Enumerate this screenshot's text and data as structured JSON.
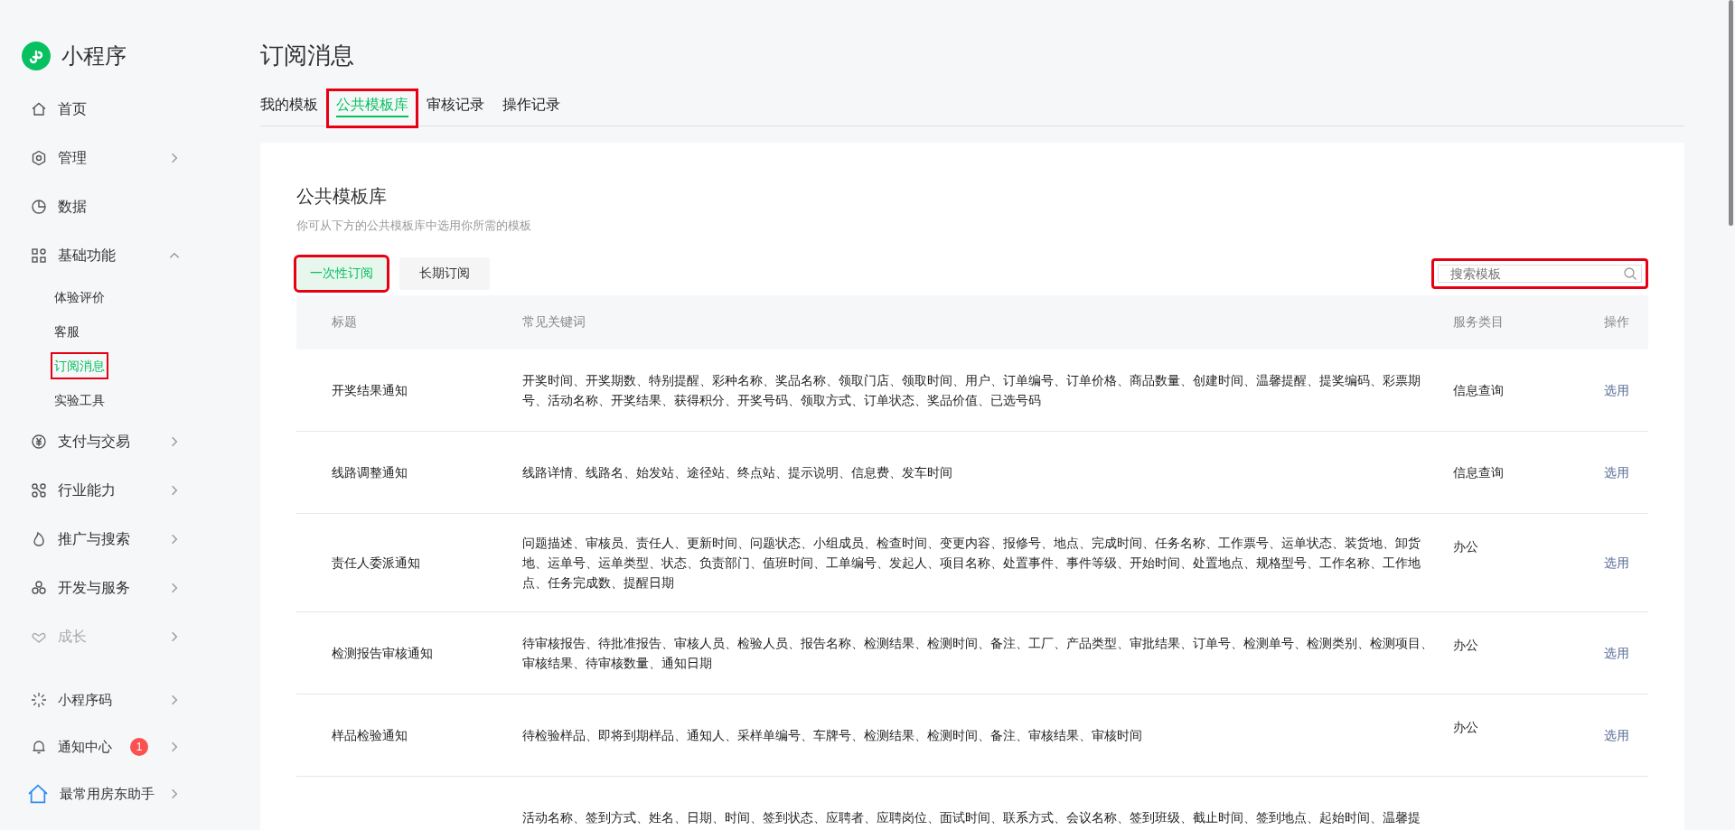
{
  "sidebar": {
    "app_name": "小程序",
    "items": [
      {
        "label": "首页",
        "disabled": false
      },
      {
        "label": "管理",
        "expanded": false,
        "disabled": false
      },
      {
        "label": "数据",
        "disabled": false
      },
      {
        "label": "基础功能",
        "expanded": true,
        "disabled": false,
        "children": [
          {
            "label": "体验评价",
            "selected": false,
            "highlighted": false
          },
          {
            "label": "客服",
            "selected": false,
            "highlighted": false
          },
          {
            "label": "订阅消息",
            "selected": true,
            "highlighted": true
          },
          {
            "label": "实验工具",
            "selected": false,
            "highlighted": false
          }
        ]
      },
      {
        "label": "支付与交易",
        "expanded": false,
        "disabled": false
      },
      {
        "label": "行业能力",
        "expanded": false,
        "disabled": false
      },
      {
        "label": "推广与搜索",
        "expanded": false,
        "disabled": false
      },
      {
        "label": "开发与服务",
        "expanded": false,
        "disabled": false
      },
      {
        "label": "成长",
        "expanded": false,
        "disabled": true
      }
    ],
    "bottom_items": [
      {
        "label": "小程序码"
      },
      {
        "label": "通知中心",
        "badge": "1"
      },
      {
        "label": "最常用房东助手"
      }
    ]
  },
  "page_title": "订阅消息",
  "tabs": [
    {
      "label": "我的模板",
      "selected": false,
      "highlighted": false
    },
    {
      "label": "公共模板库",
      "selected": true,
      "highlighted": true
    },
    {
      "label": "审核记录",
      "selected": false,
      "highlighted": false
    },
    {
      "label": "操作记录",
      "selected": false,
      "highlighted": false
    }
  ],
  "card": {
    "title": "公共模板库",
    "subtitle": "你可从下方的公共模板库中选用你所需的模板",
    "types": [
      {
        "label": "一次性订阅",
        "selected": true,
        "highlighted": true
      },
      {
        "label": "长期订阅",
        "selected": false,
        "highlighted": false
      }
    ],
    "search": {
      "placeholder": "搜索模板",
      "highlighted": true
    },
    "table": {
      "columns": [
        "标题",
        "常见关键词",
        "服务类目",
        "操作"
      ],
      "rows": [
        {
          "title": "开奖结果通知",
          "keywords": "开奖时间、开奖期数、特别提醒、彩种名称、奖品名称、领取门店、领取时间、用户、订单编号、订单价格、商品数量、创建时间、温馨提醒、提奖编码、彩票期号、活动名称、开奖结果、获得积分、开奖号码、领取方式、订单状态、奖品价值、已选号码",
          "category": "信息查询",
          "action": "选用"
        },
        {
          "title": "线路调整通知",
          "keywords": "线路详情、线路名、始发站、途径站、终点站、提示说明、信息费、发车时间",
          "category": "信息查询",
          "action": "选用"
        },
        {
          "title": "责任人委派通知",
          "keywords": "问题描述、审核员、责任人、更新时间、问题状态、小组成员、检查时间、变更内容、报修号、地点、完成时间、任务名称、工作票号、运单状态、装货地、卸货地、运单号、运单类型、状态、负责部门、值班时间、工单编号、发起人、项目名称、处置事件、事件等级、开始时间、处置地点、规格型号、工作名称、工作地点、任务完成数、提醒日期",
          "category": "办公",
          "action": "选用"
        },
        {
          "title": "检测报告审核通知",
          "keywords": "待审核报告、待批准报告、审核人员、检验人员、报告名称、检测结果、检测时间、备注、工厂、产品类型、审批结果、订单号、检测单号、检测类别、检测项目、审核结果、待审核数量、通知日期",
          "category": "办公",
          "action": "选用"
        },
        {
          "title": "样品检验通知",
          "keywords": "待检验样品、即将到期样品、通知人、采样单编号、车牌号、检测结果、检测时间、备注、审核结果、审核时间",
          "category": "办公",
          "action": "选用"
        },
        {
          "keywords": "活动名称、签到方式、姓名、日期、时间、签到状态、应聘者、应聘岗位、面试时间、联系方式、会议名称、签到班级、截止时间、签到地点、起始时间、温馨提"
        }
      ]
    }
  }
}
